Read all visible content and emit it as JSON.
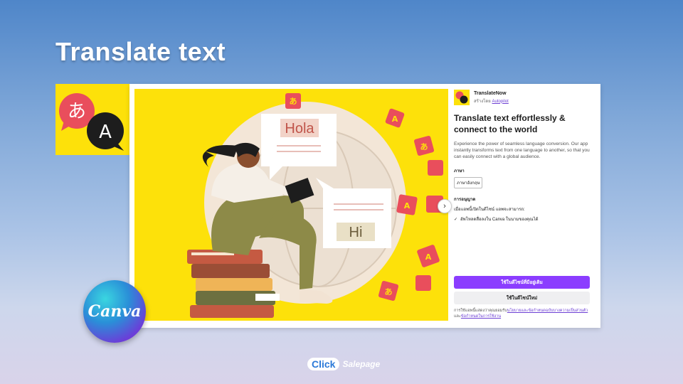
{
  "slide": {
    "title": "Translate text"
  },
  "app": {
    "name": "TranslateNow",
    "by_prefix": "สร้างโดย",
    "by_author": "Autopilot",
    "headline": "Translate text effortlessly & connect to the world",
    "description": "Experience the power of seamless language conversion. Our app instantly transforms text from one language to another, so that you can easily connect with a global audience.",
    "language_label": "ภาษา",
    "language_value": "ภาษาอังกฤษ",
    "permissions_label": "การอนุญาต",
    "permissions_intro": "เมื่อแอพนี้เปิดในดีไซน์ แอพจะสามารถ:",
    "permission_item": "อัพโหลดสื่อลงใน Canva ในนามของคุณได้",
    "primary_button": "ใช้ในดีไซน์ที่มีอยู่เดิม",
    "secondary_button": "ใช้ในดีไซน์ใหม่",
    "terms_prefix": "การใช้แอพนี้แสดงว่าคุณยอมรับ",
    "terms_link1": "นโยบายและข้อกำหนดฉบับบางความเป็นส่วนตัว",
    "terms_mid": " และ",
    "terms_link2": "ข้อกำหนดในการใช้งาน"
  },
  "illustration": {
    "bubble1": "Hola",
    "bubble2": "Hi",
    "letter_a": "A",
    "letter_kana": "あ"
  },
  "badge": {
    "text": "Canva"
  },
  "footer": {
    "click": "Click",
    "salepage": "Salepage"
  },
  "colors": {
    "yellow": "#fde10a",
    "purple": "#8b3dff",
    "red": "#e94e5c"
  }
}
